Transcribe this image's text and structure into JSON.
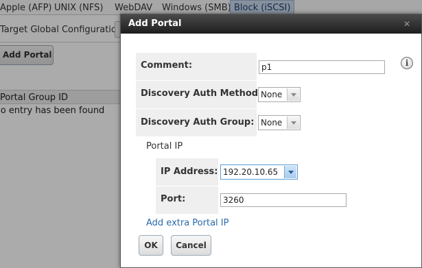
{
  "background": {
    "top_tabs": [
      "Apple (AFP)",
      "UNIX (NFS)",
      "WebDAV",
      "Windows (SMB)",
      "Block (iSCSI)"
    ],
    "sub_tab": "Target Global Configuration",
    "add_button": "Add Portal",
    "grid_header": "Portal Group ID",
    "grid_empty": "No entry has been found"
  },
  "dialog": {
    "title": "Add Portal",
    "close_icon": "close-icon",
    "comment_label": "Comment:",
    "comment_value": "p1",
    "auth_method_label": "Discovery Auth Method:",
    "auth_method_value": "None",
    "auth_group_label": "Discovery Auth Group:",
    "auth_group_value": "None",
    "portal_ip_heading": "Portal IP",
    "ip_label": "IP Address:",
    "ip_value": "192.20.10.65",
    "port_label": "Port:",
    "port_value": "3260",
    "add_extra_link": "Add extra Portal IP",
    "ok_button": "OK",
    "cancel_button": "Cancel",
    "info_icon": "info-icon"
  },
  "colors": {
    "titlebar": "#2a2a2a",
    "active_tab": "#c9d9ec",
    "link": "#2a6aa6",
    "label_bg": "#efefef"
  }
}
